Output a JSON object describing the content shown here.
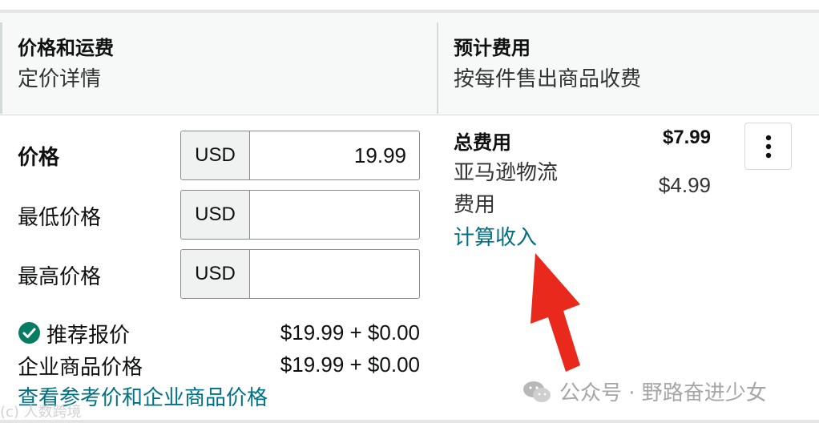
{
  "header": {
    "left": {
      "title": "价格和运费",
      "subtitle": "定价详情"
    },
    "right": {
      "title": "预计费用",
      "subtitle": "按每件售出商品收费"
    }
  },
  "pricing": {
    "price_label": "价格",
    "min_label": "最低价格",
    "max_label": "最高价格",
    "currency": "USD",
    "price_value": "19.99",
    "min_value": "",
    "max_value": ""
  },
  "offers": {
    "recommended_label": "推荐报价",
    "recommended_amount": "$19.99 + $0.00",
    "business_label": "企业商品价格",
    "business_amount": "$19.99 + $0.00",
    "view_link": "查看参考价和企业商品价格"
  },
  "fees": {
    "total_label": "总费用",
    "total_amount": "$7.99",
    "fba_label": "亚马逊物流费用",
    "fba_amount": "$4.99",
    "calc_link": "计算收入"
  },
  "annotation": {
    "arrow_color": "#e8291c"
  },
  "watermark": {
    "text": "公众号 · 野路奋进少女",
    "corner": "(c) 人数跨境"
  },
  "colors": {
    "link": "#007185",
    "check": "#067d62"
  },
  "icons": [
    "check-circle-icon",
    "kebab-menu-icon",
    "red-arrow-icon",
    "wechat-icon"
  ]
}
